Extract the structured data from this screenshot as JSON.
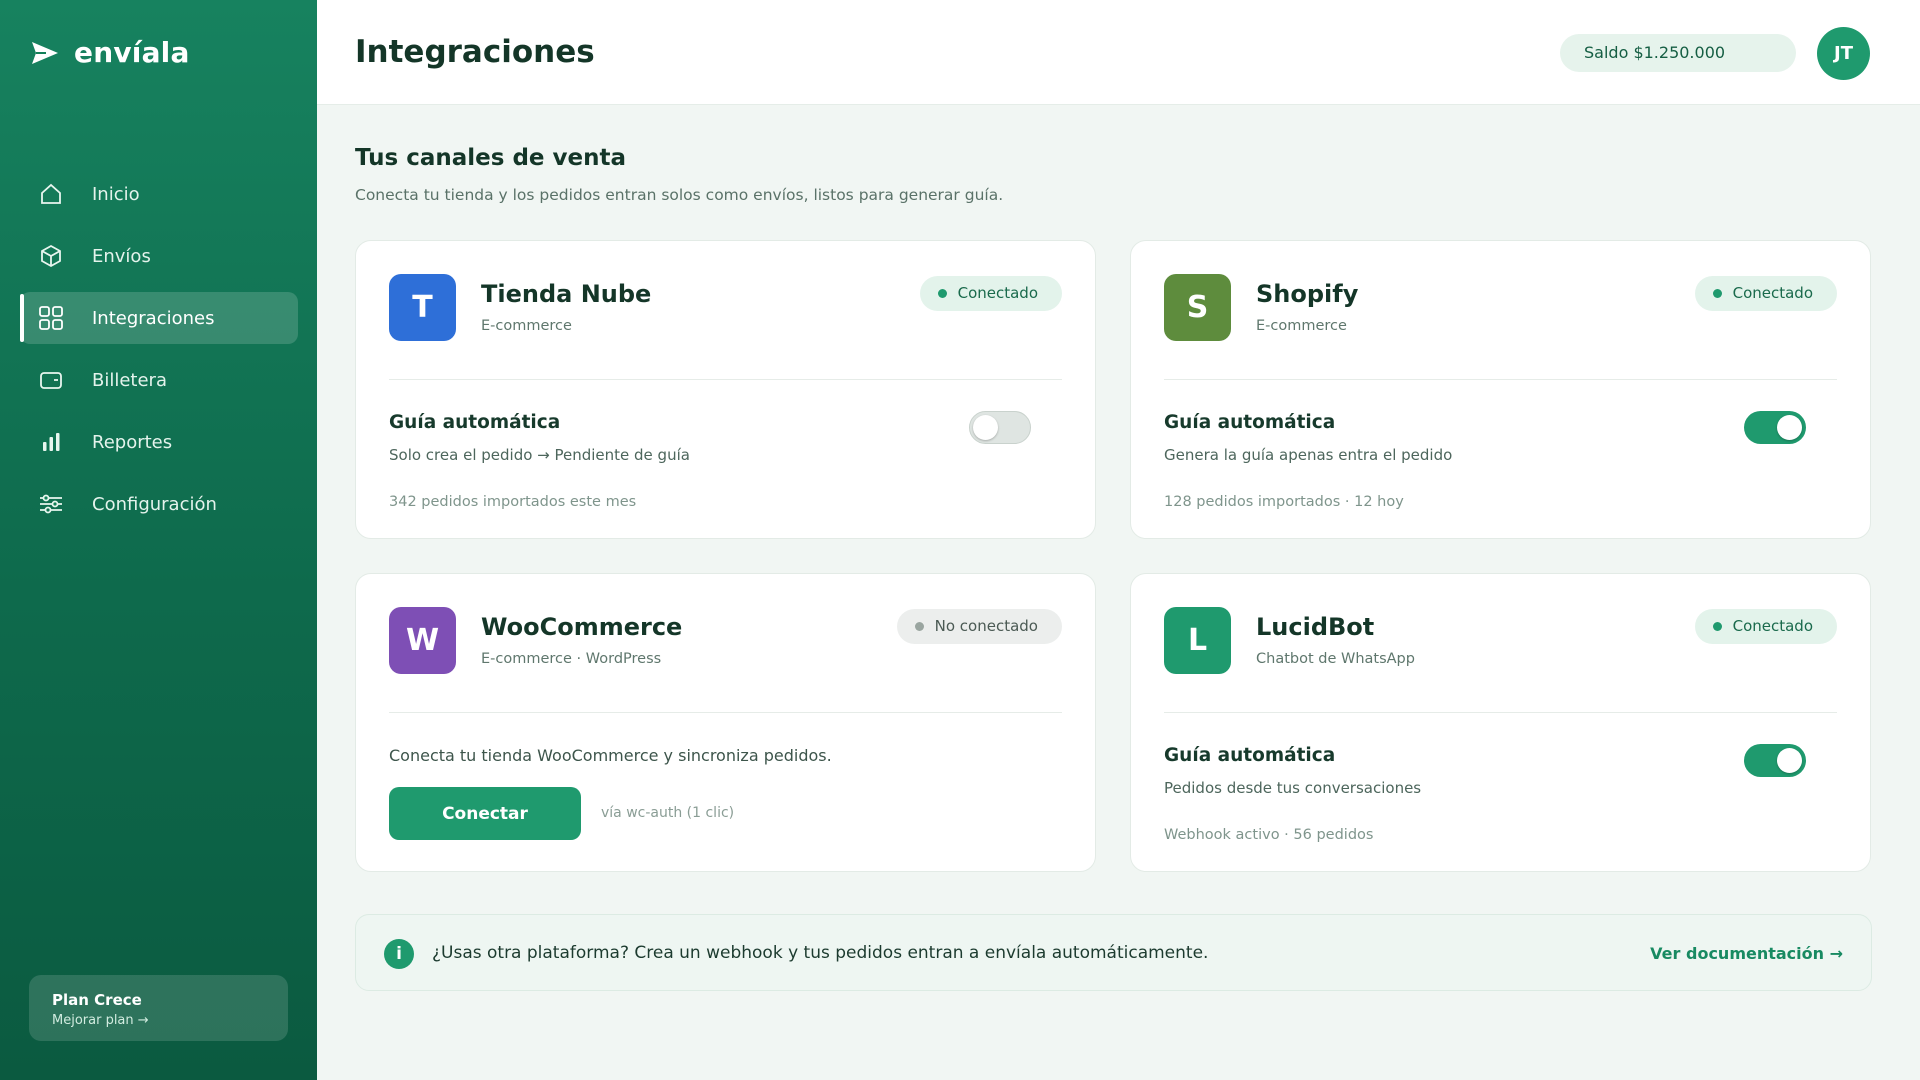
{
  "brand": {
    "name": "envíala"
  },
  "sidebar": {
    "items": [
      {
        "label": "Inicio",
        "icon": "home-icon"
      },
      {
        "label": "Envíos",
        "icon": "box-icon"
      },
      {
        "label": "Integraciones",
        "icon": "grid-icon",
        "active": true
      },
      {
        "label": "Billetera",
        "icon": "wallet-icon"
      },
      {
        "label": "Reportes",
        "icon": "bar-chart-icon"
      },
      {
        "label": "Configuración",
        "icon": "sliders-icon"
      }
    ],
    "plan": {
      "name": "Plan Crece",
      "link": "Mejorar plan →"
    }
  },
  "header": {
    "title": "Integraciones",
    "balance": "Saldo $1.250.000",
    "avatar": "JT"
  },
  "section": {
    "title": "Tus canales de venta",
    "subtitle": "Conecta tu tienda y los pedidos entran solos como envíos, listos para generar guía."
  },
  "cards": [
    {
      "letter": "T",
      "name": "Tienda Nube",
      "category": "E-commerce",
      "status": "Conectado",
      "feature_title": "Guía automática",
      "feature_desc": "Solo crea el pedido → Pendiente de guía",
      "stat": "342 pedidos importados este mes",
      "toggle_on": false,
      "color": "#2e6fd8"
    },
    {
      "letter": "S",
      "name": "Shopify",
      "category": "E-commerce",
      "status": "Conectado",
      "feature_title": "Guía automática",
      "feature_desc": "Genera la guía apenas entra el pedido",
      "stat": "128 pedidos importados · 12 hoy",
      "toggle_on": true,
      "color": "#5e8c3d"
    },
    {
      "letter": "W",
      "name": "WooCommerce",
      "category": "E-commerce · WordPress",
      "status": "No conectado",
      "connect_desc": "Conecta tu tienda WooCommerce y sincroniza pedidos.",
      "connect_button": "Conectar",
      "connect_hint": "vía wc-auth (1 clic)",
      "color": "#7e4fb5"
    },
    {
      "letter": "L",
      "name": "LucidBot",
      "category": "Chatbot de WhatsApp",
      "status": "Conectado",
      "feature_title": "Guía automática",
      "feature_desc": "Pedidos desde tus conversaciones",
      "stat": "Webhook activo · 56 pedidos",
      "toggle_on": true,
      "color": "#1f9a6e"
    }
  ],
  "banner": {
    "icon": "i",
    "text": "¿Usas otra plataforma? Crea un webhook y tus pedidos entran a envíala automáticamente.",
    "link": "Ver documentación →"
  }
}
